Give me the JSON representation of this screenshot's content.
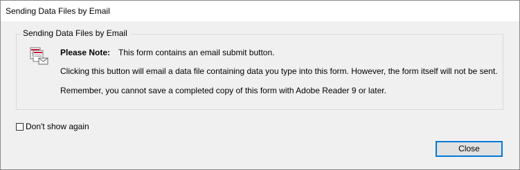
{
  "window": {
    "title": "Sending Data Files by Email"
  },
  "group": {
    "label": "Sending Data Files by Email"
  },
  "message": {
    "note_label": "Please Note:",
    "note_text": "This form contains an email submit button.",
    "line2": "Clicking this button will email a data file containing data you type into this form. However, the form itself will not be sent.",
    "line3": "Remember, you cannot save a completed copy of this form with Adobe Reader 9 or later."
  },
  "icon": {
    "name": "pdf-email-icon",
    "accent": "#c8102e"
  },
  "checkbox": {
    "label": "Don't show again",
    "checked": false
  },
  "buttons": {
    "close_label": "Close"
  },
  "colors": {
    "dialog_bg": "#f0f0f0",
    "button_border": "#0078d7",
    "button_bg": "#e1e1e1"
  }
}
